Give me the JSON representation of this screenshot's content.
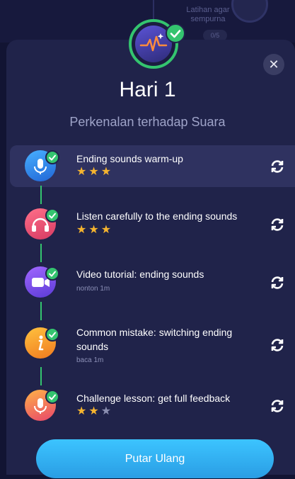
{
  "background": {
    "card_text": "Latihan agar\nsempurna",
    "card_count": "0/5"
  },
  "header": {
    "hero_icon": "heartbeat-wave-icon",
    "title": "Hari 1",
    "subtitle": "Perkenalan terhadap Suara",
    "close_icon": "close-icon"
  },
  "lessons": [
    {
      "title": "Ending sounds warm-up",
      "sub": "",
      "rating": 3,
      "icon": "microphone-icon",
      "color": "#2f86e6",
      "completed": true
    },
    {
      "title": "Listen carefully to the ending sounds",
      "sub": "",
      "rating": 3,
      "icon": "headphones-icon",
      "color": "#ec4f74",
      "completed": true
    },
    {
      "title": "Video tutorial: ending sounds",
      "sub": "nonton 1m",
      "rating": 0,
      "icon": "video-camera-icon",
      "color": "#7f49e0",
      "completed": true
    },
    {
      "title": "Common mistake: switching ending sounds",
      "sub": "baca 1m",
      "rating": 0,
      "icon": "info-icon",
      "color": "#f39a26",
      "completed": true
    },
    {
      "title": "Challenge lesson: get full feedback",
      "sub": "",
      "rating": 2,
      "max_rating": 3,
      "icon": "microphone-icon",
      "color": "#f07a3a",
      "completed": true
    }
  ],
  "cta": {
    "label": "Putar Ulang"
  },
  "colors": {
    "accent_green": "#34c46f",
    "accent_blue": "#3cc4ff",
    "sheet": "#20234a"
  }
}
